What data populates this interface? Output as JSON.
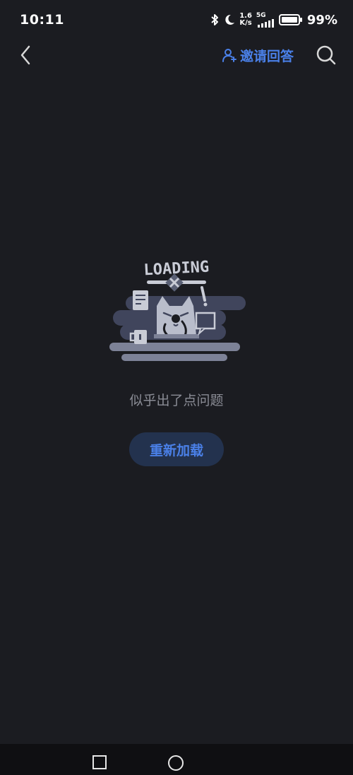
{
  "status_bar": {
    "time": "10:11",
    "net_speed_value": "1.6",
    "net_speed_unit": "K/s",
    "network_type": "5G",
    "battery_percent": "99%",
    "icons": [
      "bluetooth-icon",
      "moon-icon",
      "signal-icon",
      "battery-icon"
    ]
  },
  "nav": {
    "back_icon": "chevron-left-icon",
    "invite_label": "邀请回答",
    "invite_icon": "person-add-icon",
    "search_icon": "search-icon"
  },
  "illustration": {
    "text": "LOADING"
  },
  "main": {
    "error_message": "似乎出了点问题",
    "reload_label": "重新加载"
  },
  "bottom_nav": {
    "icons": [
      "recent-apps-icon",
      "home-icon"
    ]
  },
  "colors": {
    "background": "#1b1c21",
    "accent": "#4a80e8",
    "button_bg": "#23324e",
    "muted_text": "#8a8c95"
  }
}
